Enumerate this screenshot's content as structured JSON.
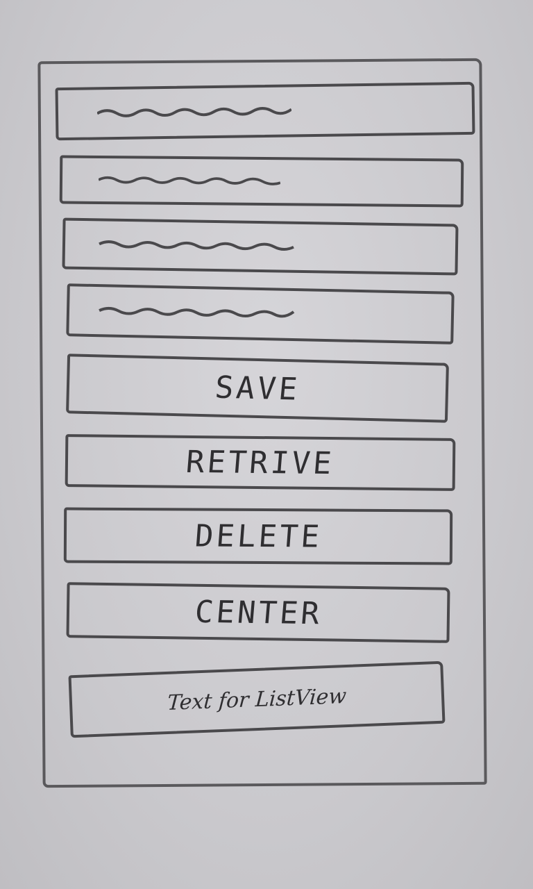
{
  "form": {
    "fields": [
      {
        "value": "",
        "placeholder": ""
      },
      {
        "value": "",
        "placeholder": ""
      },
      {
        "value": "",
        "placeholder": ""
      },
      {
        "value": "",
        "placeholder": ""
      }
    ],
    "buttons": {
      "save_label": "SAVE",
      "retrieve_label": "RETRIVE",
      "delete_label": "DELETE",
      "center_label": "CENTER"
    },
    "list_text": "Text for ListView"
  },
  "colors": {
    "ink": "#4a494c",
    "paper": "#cac9cd"
  }
}
